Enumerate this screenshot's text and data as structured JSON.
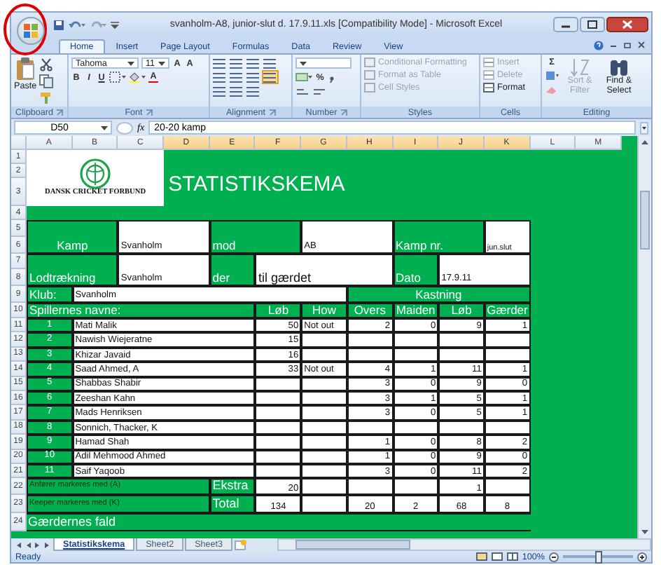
{
  "window": {
    "title": "svanholm-A8, junior-slut d. 17.9.11.xls  [Compatibility Mode] - Microsoft Excel"
  },
  "annotations": [
    {
      "kind": "circle"
    }
  ],
  "ribbon": {
    "tabs": [
      {
        "label": "Home",
        "selected": true
      },
      {
        "label": "Insert",
        "selected": false
      },
      {
        "label": "Page Layout",
        "selected": false
      },
      {
        "label": "Formulas",
        "selected": false
      },
      {
        "label": "Data",
        "selected": false
      },
      {
        "label": "Review",
        "selected": false
      },
      {
        "label": "View",
        "selected": false
      }
    ],
    "groups": [
      {
        "label": "Clipboard"
      },
      {
        "label": "Font"
      },
      {
        "label": "Alignment"
      },
      {
        "label": "Number"
      },
      {
        "label": "Styles"
      },
      {
        "label": "Cells"
      },
      {
        "label": "Editing"
      }
    ],
    "clipboard": {
      "paste": "Paste"
    },
    "font": {
      "name": "Tahoma",
      "size": "11",
      "grow": "A",
      "shrink": "A",
      "bold": "B",
      "italic": "I",
      "underline": "U",
      "text_color_button": "A"
    },
    "number": {
      "percent": "%"
    },
    "styles": [
      {
        "label": "Conditional Formatting",
        "disabled": true
      },
      {
        "label": "Format as Table",
        "disabled": true
      },
      {
        "label": "Cell Styles",
        "disabled": true
      }
    ],
    "cells": [
      {
        "label": "Insert",
        "disabled": true
      },
      {
        "label": "Delete",
        "disabled": true
      },
      {
        "label": "Format",
        "disabled": false
      }
    ],
    "editing": {
      "sum": "Σ",
      "buttons": [
        {
          "label": "Sort & Filter",
          "disabled": true
        },
        {
          "label": "Find & Select",
          "disabled": false
        }
      ]
    }
  },
  "formula_bar": {
    "name_box": "D50",
    "fx": "fx",
    "value": "20-20 kamp"
  },
  "sheet": {
    "columns": [
      {
        "label": "A",
        "selected": false
      },
      {
        "label": "B",
        "selected": false
      },
      {
        "label": "C",
        "selected": false
      },
      {
        "label": "D",
        "selected": true
      },
      {
        "label": "E",
        "selected": true
      },
      {
        "label": "F",
        "selected": true
      },
      {
        "label": "G",
        "selected": true
      },
      {
        "label": "H",
        "selected": true
      },
      {
        "label": "I",
        "selected": true
      },
      {
        "label": "J",
        "selected": true
      },
      {
        "label": "K",
        "selected": true
      },
      {
        "label": "L",
        "selected": false
      },
      {
        "label": "M",
        "selected": false
      }
    ],
    "rows": [
      "1",
      "2",
      "3",
      "4",
      "5",
      "6",
      "7",
      "8",
      "9",
      "10",
      "11",
      "12",
      "13",
      "14",
      "15",
      "16",
      "17",
      "18",
      "19",
      "20",
      "21",
      "22",
      "23",
      "24"
    ],
    "logo": "DANSK CRICKET FORBUND",
    "title": "STATISTIKSKEMA",
    "fields": [
      {
        "label": "Kamp",
        "value": "Svanholm"
      },
      {
        "label": "mod",
        "value": "AB"
      },
      {
        "label": "Kamp nr.",
        "value": "jun.slut"
      },
      {
        "label": "Lodtrækning",
        "value": "Svanholm"
      },
      {
        "label": "der",
        "value": "til gærdet"
      },
      {
        "label": "Dato",
        "value": "17.9.11"
      },
      {
        "label": "Klub:",
        "value": "Svanholm"
      }
    ],
    "batting_heading": "Spillernes navne:",
    "batting_columns": [
      "Løb",
      "How"
    ],
    "bowling_heading": "Kastning",
    "bowling_columns": [
      "Overs",
      "Maiden",
      "Løb",
      "Gærder"
    ],
    "players": [
      {
        "number": "1",
        "name": "Mati Malik",
        "runs": "50",
        "how": "Not out",
        "overs": "2",
        "maidens": "0",
        "runs_conceded": "9",
        "wickets": "1"
      },
      {
        "number": "2",
        "name": "Nawish Wiejeratne",
        "runs": "15"
      },
      {
        "number": "3",
        "name": "Khizar Javaid",
        "runs": "16"
      },
      {
        "number": "4",
        "name": "Saad Ahmed, A",
        "runs": "33",
        "how": "Not out",
        "overs": "4",
        "maidens": "1",
        "runs_conceded": "11",
        "wickets": "1"
      },
      {
        "number": "5",
        "name": "Shabbas Shabir",
        "overs": "3",
        "maidens": "0",
        "runs_conceded": "9",
        "wickets": "0"
      },
      {
        "number": "6",
        "name": "Zeeshan Kahn",
        "overs": "3",
        "maidens": "1",
        "runs_conceded": "5",
        "wickets": "1"
      },
      {
        "number": "7",
        "name": "Mads Henriksen",
        "overs": "3",
        "maidens": "0",
        "runs_conceded": "5",
        "wickets": "1"
      },
      {
        "number": "8",
        "name": "Sonnich, Thacker, K"
      },
      {
        "number": "9",
        "name": "Hamad Shah",
        "overs": "1",
        "maidens": "0",
        "runs_conceded": "8",
        "wickets": "2"
      },
      {
        "number": "10",
        "name": "Adil Mehmood Ahmed",
        "overs": "1",
        "maidens": "0",
        "runs_conceded": "9",
        "wickets": "0"
      },
      {
        "number": "11",
        "name": "Saif Yaqoob",
        "overs": "3",
        "maidens": "0",
        "runs_conceded": "11",
        "wickets": "2"
      }
    ],
    "notes": [
      "Anfører markeres med (A)",
      "Keeper markeres med (K)"
    ],
    "extras": {
      "label": "Ekstra",
      "runs": "20",
      "runs_conceded": "1"
    },
    "total": {
      "label": "Total",
      "runs": "134",
      "overs": "20",
      "maidens": "2",
      "runs_conceded": "68",
      "wickets": "8"
    },
    "section": "Gærdernes fald"
  },
  "sheet_tabs": [
    {
      "label": "Statistikskema",
      "selected": true
    },
    {
      "label": "Sheet2",
      "selected": false
    },
    {
      "label": "Sheet3",
      "selected": false
    }
  ],
  "status_bar": {
    "status": "Ready",
    "zoom": {
      "reading": "100%",
      "level": 0.5
    }
  }
}
